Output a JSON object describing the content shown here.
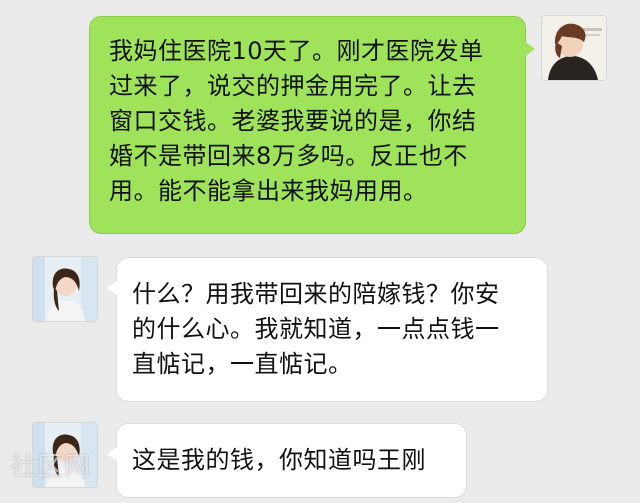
{
  "conversation": {
    "messages": [
      {
        "sender": "self",
        "text": "我妈住医院10天了。刚才医院发单\n过来了，说交的押金用完了。让去\n窗口交钱。老婆我要说的是，你结\n婚不是带回来8万多吗。反正也不\n用。能不能拿出来我妈用用。"
      },
      {
        "sender": "other",
        "text": "什么？用我带回来的陪嫁钱？你安\n的什么心。我就知道，一点点钱一\n直惦记，一直惦记。"
      },
      {
        "sender": "other",
        "text": "这是我的钱，你知道吗王刚"
      }
    ]
  },
  "watermark": {
    "text": "社区网"
  },
  "colors": {
    "background": "#ebebeb",
    "outgoing_bubble": "#9fe35a",
    "incoming_bubble": "#ffffff"
  }
}
